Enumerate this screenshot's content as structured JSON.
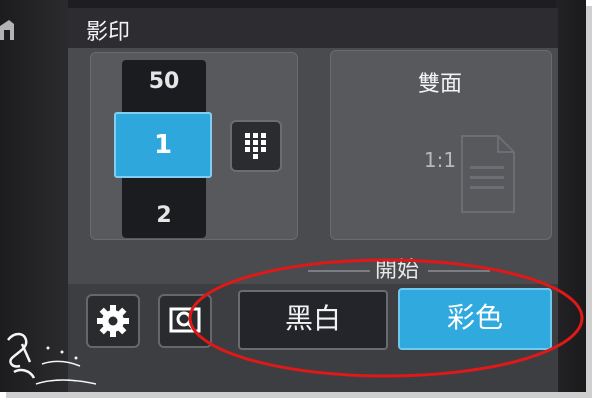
{
  "screen": {
    "title": "影印"
  },
  "copies": {
    "upper_value": "50",
    "selected_value": "1",
    "lower_value": "2",
    "keypad_icon": "keypad-icon"
  },
  "duplex": {
    "title": "雙面",
    "value": "1:1"
  },
  "start": {
    "label": "開始",
    "black_white_label": "黑白",
    "color_label": "彩色"
  },
  "bottom_icons": {
    "settings": "gear-icon",
    "preview": "preview-icon"
  },
  "colors": {
    "accent": "#2ea8dc",
    "highlight_oval": "#e01818"
  }
}
